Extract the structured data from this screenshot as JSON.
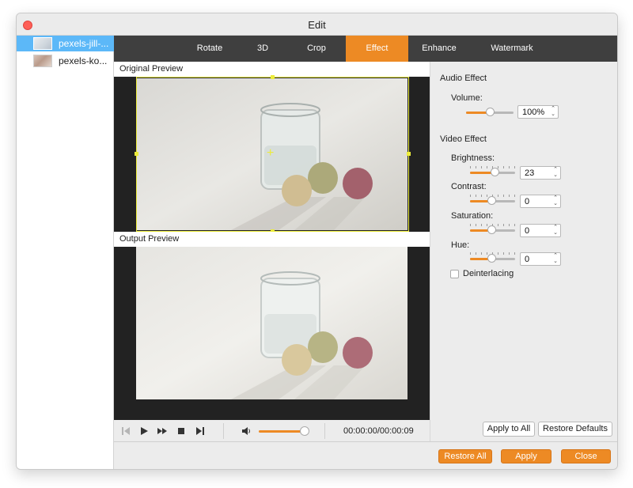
{
  "window": {
    "title": "Edit"
  },
  "files": [
    {
      "name": "pexels-jill-...",
      "selected": true
    },
    {
      "name": "pexels-ko...",
      "selected": false
    }
  ],
  "tabs": [
    {
      "label": "Rotate",
      "active": false
    },
    {
      "label": "3D",
      "active": false
    },
    {
      "label": "Crop",
      "active": false
    },
    {
      "label": "Effect",
      "active": true
    },
    {
      "label": "Enhance",
      "active": false
    },
    {
      "label": "Watermark",
      "active": false
    }
  ],
  "preview": {
    "original_label": "Original Preview",
    "output_label": "Output Preview",
    "timecode": "00:00:00/00:00:09",
    "timeline_progress": 0.0
  },
  "audio_effect": {
    "title": "Audio Effect",
    "volume_label": "Volume:",
    "volume_value": "100%"
  },
  "video_effect": {
    "title": "Video Effect",
    "brightness_label": "Brightness:",
    "brightness_value": "23",
    "contrast_label": "Contrast:",
    "contrast_value": "0",
    "saturation_label": "Saturation:",
    "saturation_value": "0",
    "hue_label": "Hue:",
    "hue_value": "0",
    "deinterlacing_label": "Deinterlacing",
    "deinterlacing_checked": false
  },
  "buttons": {
    "apply_to_all": "Apply to All",
    "restore_defaults": "Restore Defaults",
    "restore_all": "Restore All",
    "apply": "Apply",
    "close": "Close"
  },
  "colors": {
    "accent": "#ed8a24",
    "tab_bar": "#3f3f3f",
    "selection": "#5cb8f8",
    "crop_frame": "#ecec3b"
  }
}
